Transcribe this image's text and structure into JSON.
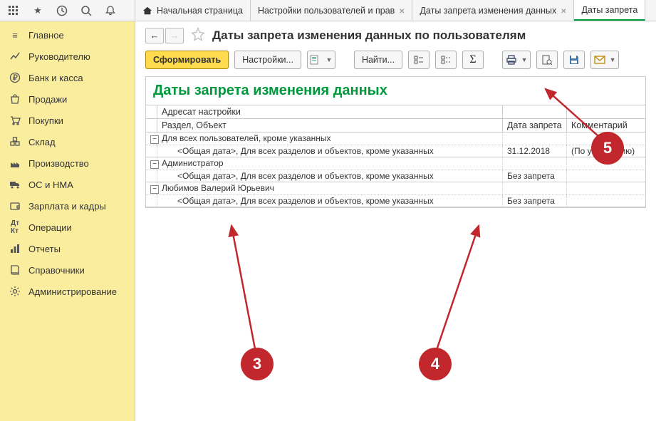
{
  "tabs": {
    "home": "Начальная страница",
    "t1": "Настройки пользователей и прав",
    "t2": "Даты запрета изменения данных",
    "t3": "Даты запрета"
  },
  "sidebar": {
    "items": [
      "Главное",
      "Руководителю",
      "Банк и касса",
      "Продажи",
      "Покупки",
      "Склад",
      "Производство",
      "ОС и НМА",
      "Зарплата и кадры",
      "Операции",
      "Отчеты",
      "Справочники",
      "Администрирование"
    ]
  },
  "page": {
    "title": "Даты запрета изменения данных по пользователям"
  },
  "toolbar": {
    "generate": "Сформировать",
    "settings": "Настройки...",
    "find": "Найти..."
  },
  "report": {
    "title": "Даты запрета изменения данных",
    "head_label1": "Адресат настройки",
    "head_label2": "Раздел, Объект",
    "col_date": "Дата запрета",
    "col_comment": "Комментарий",
    "rows": [
      {
        "group": "Для всех пользователей, кроме указанных",
        "detail": "<Общая дата>, Для всех разделов и объектов, кроме указанных",
        "date": "31.12.2018",
        "comment": "(По умолчанию)"
      },
      {
        "group": "Администратор",
        "detail": "<Общая дата>, Для всех разделов и объектов, кроме указанных",
        "date": "Без запрета",
        "comment": ""
      },
      {
        "group": "Любимов Валерий Юрьевич",
        "detail": "<Общая дата>, Для всех разделов и объектов, кроме указанных",
        "date": "Без запрета",
        "comment": ""
      }
    ]
  },
  "markers": {
    "m3": "3",
    "m4": "4",
    "m5": "5"
  }
}
